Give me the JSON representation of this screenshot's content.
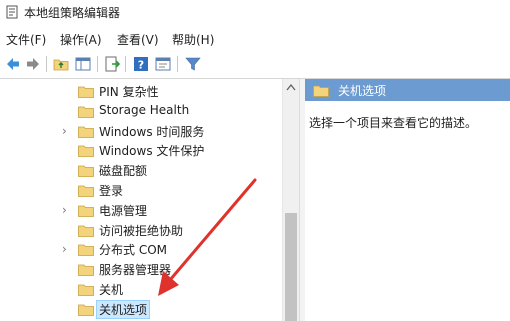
{
  "window": {
    "title": "本地组策略编辑器"
  },
  "menu": [
    {
      "label": "文件(F)"
    },
    {
      "label": "操作(A)"
    },
    {
      "label": "查看(V)"
    },
    {
      "label": "帮助(H)"
    }
  ],
  "toolbar": {
    "icons": [
      "back-icon",
      "forward-icon",
      "up-folder-icon",
      "show-hide-tree-icon",
      "export-list-icon",
      "help-icon",
      "properties-icon",
      "filter-icon"
    ]
  },
  "tree": {
    "items": [
      {
        "label": "PIN 复杂性",
        "expandable": false
      },
      {
        "label": "Storage Health",
        "expandable": false
      },
      {
        "label": "Windows 时间服务",
        "expandable": true
      },
      {
        "label": "Windows 文件保护",
        "expandable": false
      },
      {
        "label": "磁盘配额",
        "expandable": false
      },
      {
        "label": "登录",
        "expandable": false
      },
      {
        "label": "电源管理",
        "expandable": true
      },
      {
        "label": "访问被拒绝协助",
        "expandable": false
      },
      {
        "label": "分布式 COM",
        "expandable": true
      },
      {
        "label": "服务器管理器",
        "expandable": false
      },
      {
        "label": "关机",
        "expandable": false
      },
      {
        "label": "关机选项",
        "expandable": false,
        "selected": true
      }
    ]
  },
  "details": {
    "header": "关机选项",
    "description": "选择一个项目来查看它的描述。"
  },
  "colors": {
    "header_bg": "#6b9bd1",
    "folder": "#f3d37b",
    "annotation_arrow": "#e0322c"
  }
}
